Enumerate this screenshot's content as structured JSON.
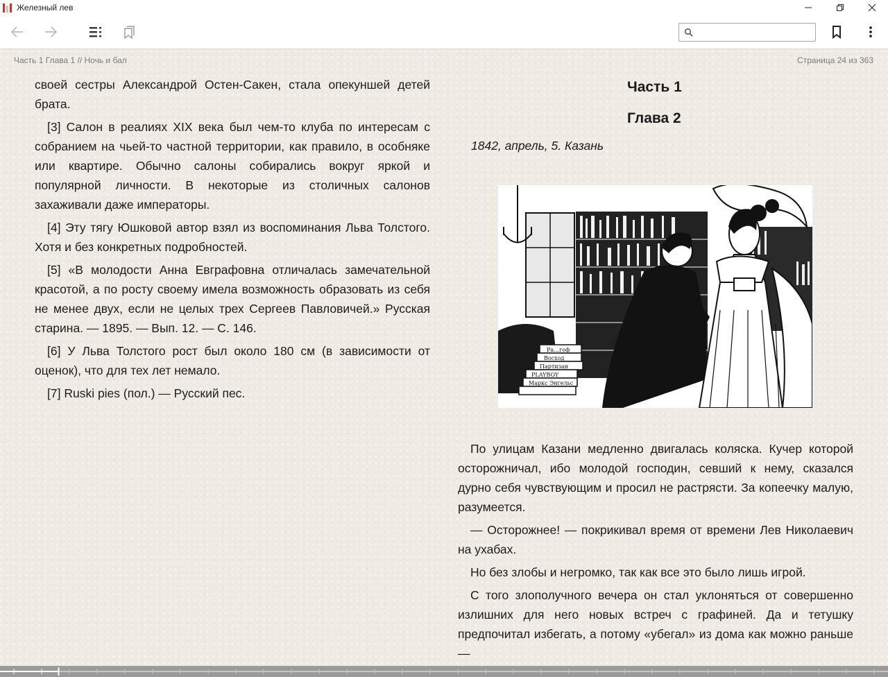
{
  "window": {
    "title": "Железный лев"
  },
  "toolbar": {
    "search_placeholder": "",
    "search_value": ""
  },
  "page": {
    "chapter_path": "Часть 1 Глава 1 // Ночь и бал",
    "page_indicator": "Страница 24 из 363"
  },
  "left_column": {
    "paragraphs": [
      "своей сестры Александрой Остен-Сакен, стала опекуншей детей брата.",
      "[3] Салон в реалиях XIX века был чем-то клуба по интересам с собранием на чьей-то частной территории, как правило, в особняке или квартире. Обычно салоны собирались вокруг яркой и популярной личности. В некоторые из столичных салонов захаживали даже императоры.",
      "[4] Эту тягу Юшковой автор взял из воспоминания Льва Толстого. Хотя и без конкретных подробностей.",
      "[5] «В молодости Анна Евграфовна отличалась замечательной красотой, а по росту своему имела возможность образовать из себя не менее двух, если не целых трех Сергеев Павловичей.» Русская старина. — 1895. — Вып. 12. — С. 146.",
      "[6] У Льва Толстого рост был около 180 см (в зависимости от оценок), что для тех лет немало.",
      "[7] Ruski pies (пол.) — Русский пес."
    ]
  },
  "right_column": {
    "part_heading": "Часть 1",
    "chapter_heading": "Глава 2",
    "date_line": "1842, апрель, 5. Казань",
    "illustration_book_spines": [
      "Ра…гоф",
      "Восход",
      "Партизан",
      "PLAYBOY",
      "Маркс Энгельс"
    ],
    "paragraphs": [
      "По улицам Казани медленно двигалась коляска. Кучер которой осторожничал, ибо молодой господин, севший к нему, сказался дурно себя чувствующим и просил не растрясти. За копеечку малую, разумеется.",
      "— Осторожнее! — покрикивал время от времени Лев Николаевич на ухабах.",
      "Но без злобы и негромко, так как все это было лишь игрой.",
      "С того злополучного вечера он стал уклоняться от совершенно излишних для него новых встреч с графиней. Да и тетушку предпочитал избегать, а потому «убегал» из дома как можно раньше —"
    ]
  },
  "progress": {
    "fraction": 0.066
  }
}
